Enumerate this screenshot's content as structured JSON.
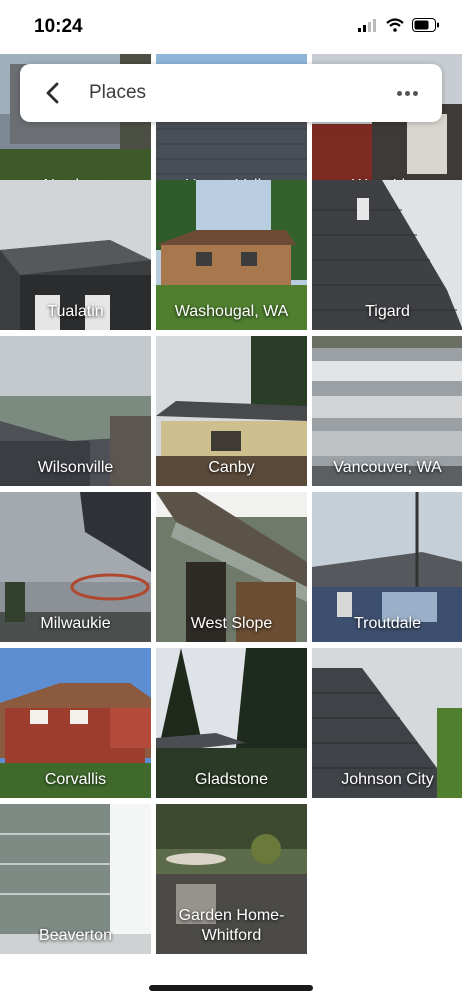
{
  "status": {
    "time": "10:24"
  },
  "header": {
    "title": "Places"
  },
  "places": [
    {
      "name": "Newberg"
    },
    {
      "name": "Happy Valley"
    },
    {
      "name": "West Linn"
    },
    {
      "name": "Tualatin"
    },
    {
      "name": "Washougal, WA"
    },
    {
      "name": "Tigard"
    },
    {
      "name": "Wilsonville"
    },
    {
      "name": "Canby"
    },
    {
      "name": "Vancouver, WA"
    },
    {
      "name": "Milwaukie"
    },
    {
      "name": "West Slope"
    },
    {
      "name": "Troutdale"
    },
    {
      "name": "Corvallis"
    },
    {
      "name": "Gladstone"
    },
    {
      "name": "Johnson City"
    },
    {
      "name": "Beaverton"
    },
    {
      "name": "Garden Home-Whitford"
    }
  ],
  "icons": {
    "back": "back-arrow-icon",
    "more": "more-options-icon",
    "signal": "cellular-signal-icon",
    "wifi": "wifi-icon",
    "battery": "battery-icon"
  }
}
